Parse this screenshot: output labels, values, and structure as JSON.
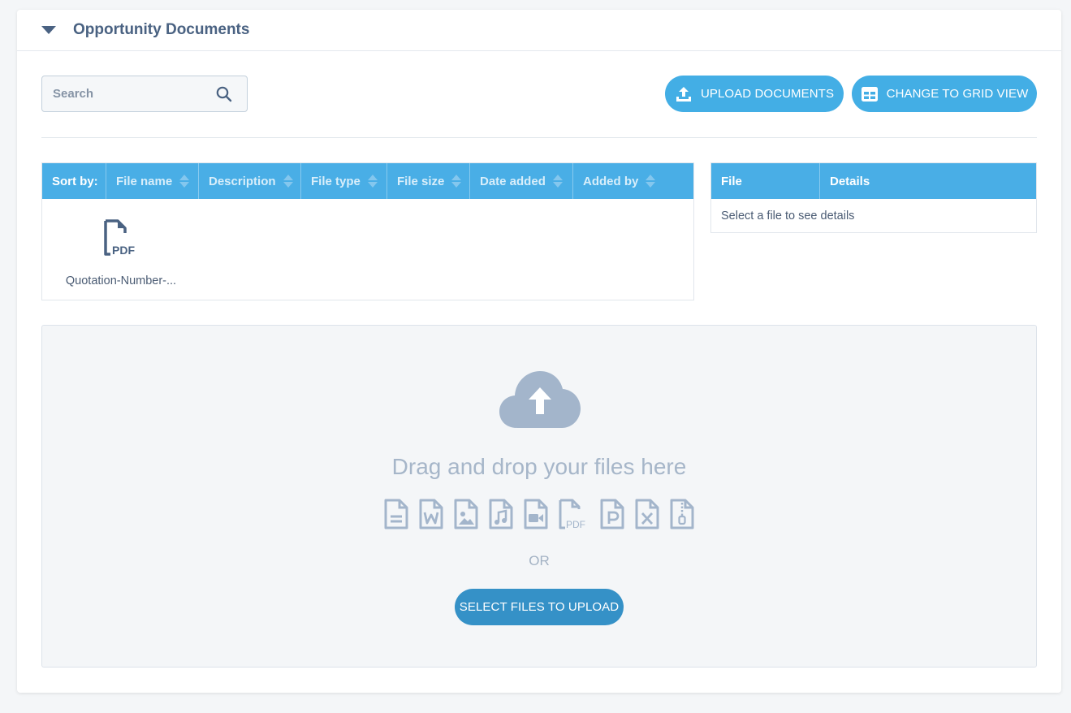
{
  "panel": {
    "title": "Opportunity Documents"
  },
  "search": {
    "placeholder": "Search",
    "value": ""
  },
  "toolbar": {
    "upload_label": "UPLOAD DOCUMENTS",
    "grid_view_label": "CHANGE TO GRID VIEW"
  },
  "files_table": {
    "sort_label": "Sort by:",
    "columns": [
      "File name",
      "Description",
      "File type",
      "File size",
      "Date added",
      "Added by"
    ],
    "files": [
      {
        "name": "Quotation-Number-...",
        "type_label": "PDF",
        "icon": "pdf-file-icon"
      }
    ]
  },
  "details_table": {
    "columns": [
      "File",
      "Details"
    ],
    "empty_text": "Select a file to see details"
  },
  "dropzone": {
    "icon": "cloud-upload-icon",
    "text": "Drag and drop your files here",
    "file_type_icons": [
      "text-file-icon",
      "word-file-icon",
      "image-file-icon",
      "audio-file-icon",
      "video-file-icon",
      "pdf-file-icon",
      "powerpoint-file-icon",
      "excel-file-icon",
      "zip-file-icon"
    ],
    "pdf_icon_label": "PDF",
    "or_text": "OR",
    "select_label": "SELECT FILES TO UPLOAD"
  },
  "colors": {
    "accent": "#43aee5",
    "header_blue": "#49aee6",
    "select_button": "#3591c7",
    "title": "#4a6282",
    "dropzone_icon": "#a3b5cb"
  }
}
